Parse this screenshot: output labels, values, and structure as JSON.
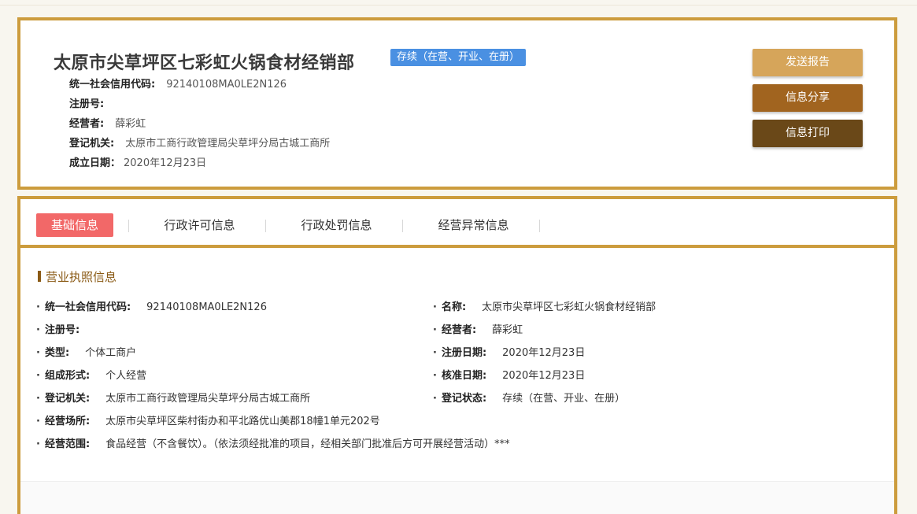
{
  "header": {
    "company_name": "太原市尖草坪区七彩虹火锅食材经销部",
    "status": "存续（在营、开业、在册）",
    "info": [
      {
        "label": "统一社会信用代码:",
        "value": "92140108MA0LE2N126"
      },
      {
        "label": "注册号:",
        "value": ""
      },
      {
        "label": "经营者:",
        "value": "薛彩虹"
      },
      {
        "label": "登记机关:",
        "value": "太原市工商行政管理局尖草坪分局古城工商所"
      },
      {
        "label": "成立日期：",
        "value": "2020年12月23日"
      }
    ],
    "buttons": {
      "report": "发送报告",
      "share": "信息分享",
      "print": "信息打印"
    }
  },
  "tabs": [
    {
      "label": "基础信息",
      "active": true
    },
    {
      "label": "行政许可信息",
      "active": false
    },
    {
      "label": "行政处罚信息",
      "active": false
    },
    {
      "label": "经营异常信息",
      "active": false
    }
  ],
  "section": {
    "title": "营业执照信息",
    "left": [
      {
        "label": "统一社会信用代码:",
        "value": "92140108MA0LE2N126"
      },
      {
        "label": "注册号:",
        "value": ""
      },
      {
        "label": "类型:",
        "value": "个体工商户"
      },
      {
        "label": "组成形式:",
        "value": "个人经营"
      },
      {
        "label": "登记机关:",
        "value": "太原市工商行政管理局尖草坪分局古城工商所"
      },
      {
        "label": "经营场所:",
        "value": "太原市尖草坪区柴村街办和平北路优山美郡18幢1单元202号"
      },
      {
        "label": "经营范围:",
        "value": "食品经营（不含餐饮）。（依法须经批准的项目，经相关部门批准后方可开展经营活动）***"
      }
    ],
    "right": [
      {
        "label": "名称:",
        "value": "太原市尖草坪区七彩虹火锅食材经销部"
      },
      {
        "label": "经营者:",
        "value": "薛彩虹"
      },
      {
        "label": "注册日期:",
        "value": "2020年12月23日"
      },
      {
        "label": "核准日期:",
        "value": "2020年12月23日"
      },
      {
        "label": "登记状态:",
        "value": "存续（在营、开业、在册）"
      }
    ]
  },
  "colors": {
    "border": "#cc9c3d",
    "badge": "#4a90e2",
    "active_tab": "#f26868",
    "btn_report": "#d6a55a",
    "btn_share": "#a1641f",
    "btn_print": "#6a4818"
  }
}
